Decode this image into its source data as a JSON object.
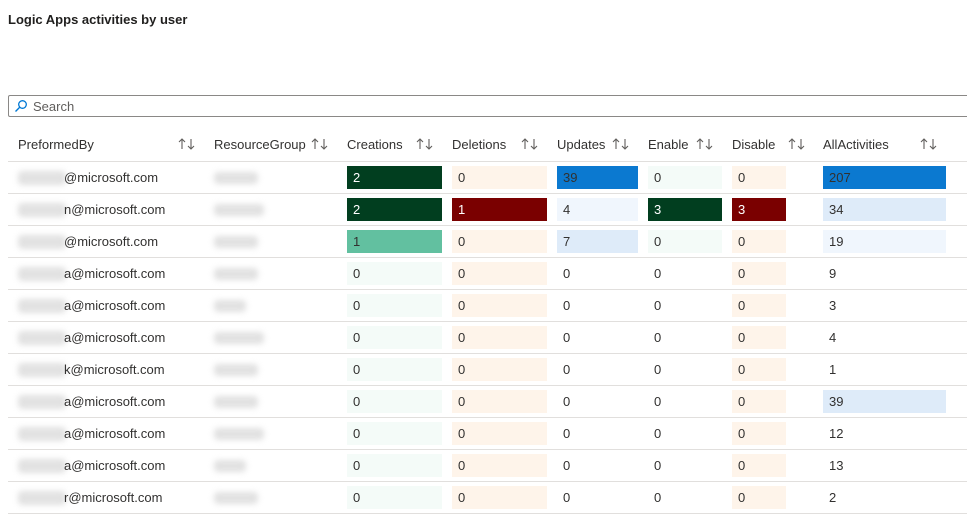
{
  "title": "Logic Apps activities by user",
  "search": {
    "placeholder": "Search",
    "value": ""
  },
  "columns": [
    {
      "label": "PreformedBy"
    },
    {
      "label": "ResourceGroup"
    },
    {
      "label": "Creations"
    },
    {
      "label": "Deletions"
    },
    {
      "label": "Updates"
    },
    {
      "label": "Enable"
    },
    {
      "label": "Disable"
    },
    {
      "label": "AllActivities"
    }
  ],
  "colors": {
    "green_dark": "#013e1f",
    "green_light": "#62c0a0",
    "green_faint": "#f4fbf8",
    "red_dark": "#7a0000",
    "peach_faint": "#fef4ea",
    "blue_strong": "#0b79d0",
    "blue_light": "#deebf9",
    "blue_faint": "#f0f6fd"
  },
  "rows": [
    {
      "email": "@microsoft.com",
      "values": [
        2,
        0,
        39,
        0,
        0,
        207
      ]
    },
    {
      "email": "n@microsoft.com",
      "values": [
        2,
        1,
        4,
        3,
        3,
        34
      ]
    },
    {
      "email": "@microsoft.com",
      "values": [
        1,
        0,
        7,
        0,
        0,
        19
      ]
    },
    {
      "email": "a@microsoft.com",
      "values": [
        0,
        0,
        0,
        0,
        0,
        9
      ]
    },
    {
      "email": "a@microsoft.com",
      "values": [
        0,
        0,
        0,
        0,
        0,
        3
      ]
    },
    {
      "email": "a@microsoft.com",
      "values": [
        0,
        0,
        0,
        0,
        0,
        4
      ]
    },
    {
      "email": "k@microsoft.com",
      "values": [
        0,
        0,
        0,
        0,
        0,
        1
      ]
    },
    {
      "email": "a@microsoft.com",
      "values": [
        0,
        0,
        0,
        0,
        0,
        39
      ]
    },
    {
      "email": "a@microsoft.com",
      "values": [
        0,
        0,
        0,
        0,
        0,
        12
      ]
    },
    {
      "email": "a@microsoft.com",
      "values": [
        0,
        0,
        0,
        0,
        0,
        13
      ]
    },
    {
      "email": "r@microsoft.com",
      "values": [
        0,
        0,
        0,
        0,
        0,
        2
      ]
    }
  ],
  "cell_colors": [
    [
      "green_dark",
      "peach_faint",
      "blue_strong",
      "green_faint",
      "peach_faint",
      "blue_strong"
    ],
    [
      "green_dark",
      "red_dark",
      "blue_faint",
      "green_dark",
      "red_dark",
      "blue_light"
    ],
    [
      "green_light",
      "peach_faint",
      "blue_light",
      "green_faint",
      "peach_faint",
      "blue_faint"
    ],
    [
      "green_faint",
      "peach_faint",
      "none",
      "none",
      "peach_faint",
      "none"
    ],
    [
      "green_faint",
      "peach_faint",
      "none",
      "none",
      "peach_faint",
      "none"
    ],
    [
      "green_faint",
      "peach_faint",
      "none",
      "none",
      "peach_faint",
      "none"
    ],
    [
      "green_faint",
      "peach_faint",
      "none",
      "none",
      "peach_faint",
      "none"
    ],
    [
      "green_faint",
      "peach_faint",
      "none",
      "none",
      "peach_faint",
      "blue_light"
    ],
    [
      "green_faint",
      "peach_faint",
      "none",
      "none",
      "peach_faint",
      "none"
    ],
    [
      "green_faint",
      "peach_faint",
      "none",
      "none",
      "peach_faint",
      "none"
    ],
    [
      "green_faint",
      "peach_faint",
      "none",
      "none",
      "peach_faint",
      "none"
    ]
  ],
  "text_colors": [
    [
      "light",
      "dark",
      "dark",
      "dark",
      "dark",
      "dark"
    ],
    [
      "light",
      "light",
      "dark",
      "light",
      "light",
      "dark"
    ],
    [
      "dark",
      "dark",
      "dark",
      "dark",
      "dark",
      "dark"
    ]
  ]
}
